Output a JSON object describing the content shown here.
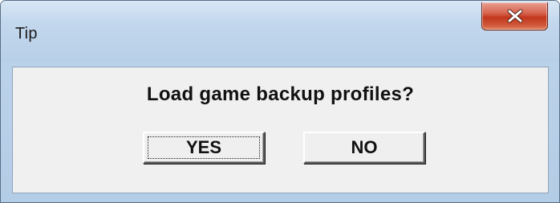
{
  "window": {
    "title": "Tip",
    "close_icon": "close-icon"
  },
  "dialog": {
    "message": "Load game backup profiles?",
    "buttons": {
      "yes_label": "YES",
      "no_label": "NO"
    },
    "focused_button": "YES"
  },
  "colors": {
    "close_button": "#c2371d",
    "frame": "#b7cfe8",
    "client_background": "#f0f0f0"
  }
}
